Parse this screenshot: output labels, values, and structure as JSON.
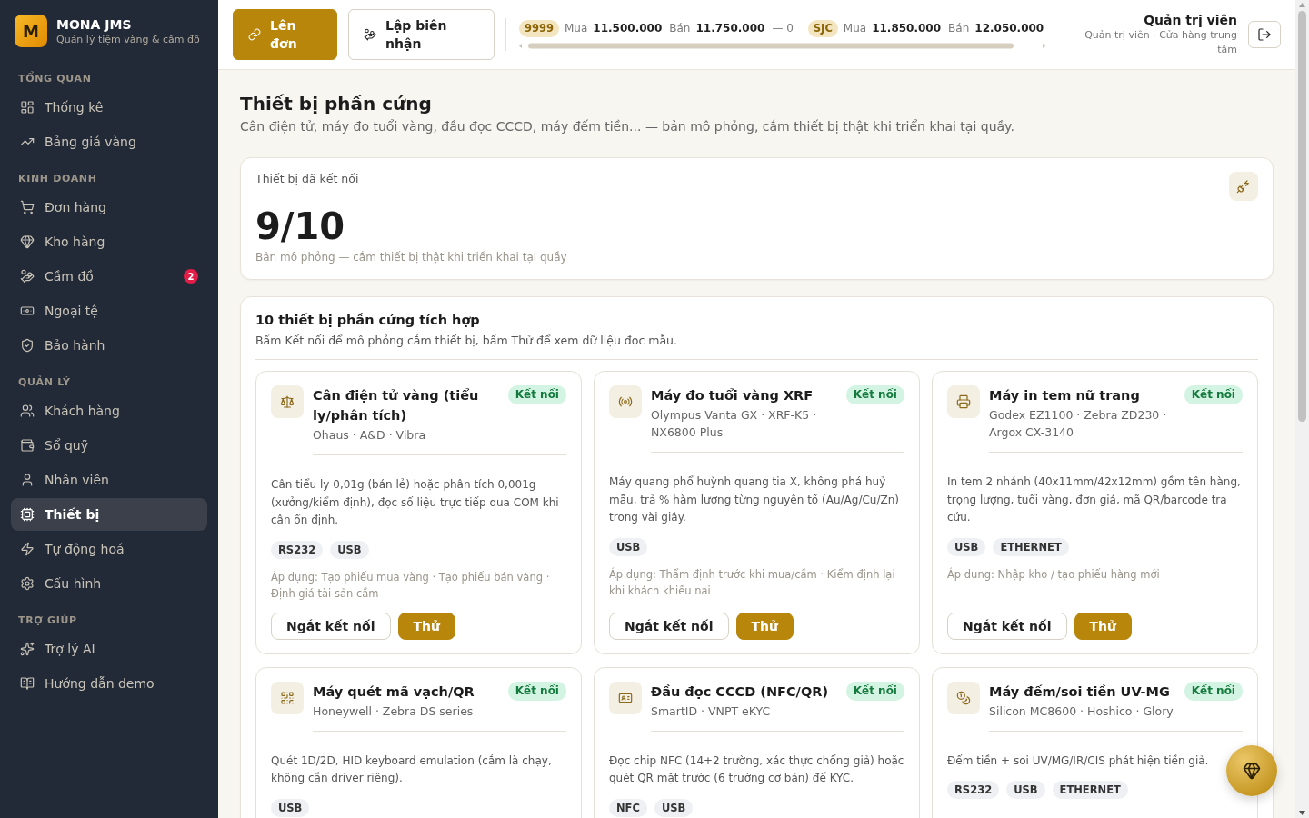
{
  "sidebar": {
    "brand": {
      "logo_letter": "M",
      "name": "MONA JMS",
      "tagline": "Quản lý tiệm vàng & cầm đồ"
    },
    "sections": [
      {
        "title": "TỔNG QUAN",
        "items": [
          {
            "label": "Thống kê",
            "selected": false
          },
          {
            "label": "Bảng giá vàng",
            "selected": false
          }
        ]
      },
      {
        "title": "KINH DOANH",
        "items": [
          {
            "label": "Đơn hàng",
            "selected": false
          },
          {
            "label": "Kho hàng",
            "selected": false
          },
          {
            "label": "Cầm đồ",
            "selected": false,
            "badge": "2"
          },
          {
            "label": "Ngoại tệ",
            "selected": false
          },
          {
            "label": "Bảo hành",
            "selected": false
          }
        ]
      },
      {
        "title": "QUẢN LÝ",
        "items": [
          {
            "label": "Khách hàng",
            "selected": false
          },
          {
            "label": "Sổ quỹ",
            "selected": false
          },
          {
            "label": "Nhân viên",
            "selected": false
          },
          {
            "label": "Thiết bị",
            "selected": true
          },
          {
            "label": "Tự động hoá",
            "selected": false
          },
          {
            "label": "Cấu hình",
            "selected": false
          }
        ]
      },
      {
        "title": "TRỢ GIÚP",
        "items": [
          {
            "label": "Trợ lý AI",
            "selected": false
          },
          {
            "label": "Hướng dẫn demo",
            "selected": false
          }
        ]
      }
    ]
  },
  "topbar": {
    "actions": [
      {
        "label": "Lên đơn",
        "kind": "primary"
      },
      {
        "label": "Lập biên nhận",
        "kind": "secondary"
      }
    ],
    "ticker": [
      {
        "code": "9999",
        "buy_label": "Mua",
        "buy": "11.500.000",
        "sell_label": "Bán",
        "sell": "11.750.000",
        "change": "— 0"
      },
      {
        "code": "SJC",
        "buy_label": "Mua",
        "buy": "11.850.000",
        "sell_label": "Bán",
        "sell": "12.050.000"
      }
    ],
    "user": {
      "name": "Quản trị viên",
      "role": "Quản trị viên · Cửa hàng trung tâm"
    }
  },
  "page": {
    "title": "Thiết bị phần cứng",
    "subtitle": "Cân điện tử, máy đo tuổi vàng, đầu đọc CCCD, máy đếm tiền... — bản mô phỏng, cắm thiết bị thật khi triển khai tại quầy."
  },
  "stat": {
    "label": "Thiết bị đã kết nối",
    "value": "9/10",
    "note": "Bản mô phỏng — cắm thiết bị thật khi triển khai tại quầy"
  },
  "devices": {
    "title": "10 thiết bị phần cứng tích hợp",
    "subtitle": "Bấm Kết nối để mô phỏng cắm thiết bị, bấm Thử để xem dữ liệu đọc mẫu.",
    "items": [
      {
        "name": "Cân điện tử vàng (tiểu ly/phân tích)",
        "status": "Kết nối",
        "models": "Ohaus · A&D · Vibra",
        "description": "Cân tiểu ly 0,01g (bán lẻ) hoặc phân tích 0,001g (xưởng/kiểm định), đọc số liệu trực tiếp qua COM khi cân ổn định.",
        "tags": [
          "RS232",
          "USB"
        ],
        "applies": "Áp dụng: Tạo phiếu mua vàng · Tạo phiếu bán vàng · Định giá tài sản cầm",
        "actions": [
          {
            "label": "Ngắt kết nối",
            "kind": "outline"
          },
          {
            "label": "Thử",
            "kind": "primary"
          }
        ]
      },
      {
        "name": "Máy đo tuổi vàng XRF",
        "status": "Kết nối",
        "models": "Olympus Vanta GX · XRF-K5 · NX6800 Plus",
        "description": "Máy quang phổ huỳnh quang tia X, không phá huỷ mẫu, trả % hàm lượng từng nguyên tố (Au/Ag/Cu/Zn) trong vài giây.",
        "tags": [
          "USB"
        ],
        "applies": "Áp dụng: Thẩm định trước khi mua/cầm · Kiểm định lại khi khách khiếu nại",
        "actions": [
          {
            "label": "Ngắt kết nối",
            "kind": "outline"
          },
          {
            "label": "Thử",
            "kind": "primary"
          }
        ]
      },
      {
        "name": "Máy in tem nữ trang",
        "status": "Kết nối",
        "models": "Godex EZ1100 · Zebra ZD230 · Argox CX-3140",
        "description": "In tem 2 nhánh (40x11mm/42x12mm) gồm tên hàng, trọng lượng, tuổi vàng, đơn giá, mã QR/barcode tra cứu.",
        "tags": [
          "USB",
          "ETHERNET"
        ],
        "applies": "Áp dụng: Nhập kho / tạo phiếu hàng mới",
        "actions": [
          {
            "label": "Ngắt kết nối",
            "kind": "outline"
          },
          {
            "label": "Thử",
            "kind": "primary"
          }
        ]
      },
      {
        "name": "Máy quét mã vạch/QR",
        "status": "Kết nối",
        "models": "Honeywell · Zebra DS series",
        "description": "Quét 1D/2D, HID keyboard emulation (cắm là chạy, không cần driver riêng).",
        "tags": [
          "USB"
        ]
      },
      {
        "name": "Đầu đọc CCCD (NFC/QR)",
        "status": "Kết nối",
        "models": "SmartID · VNPT eKYC",
        "description": "Đọc chip NFC (14+2 trường, xác thực chống giả) hoặc quét QR mặt trước (6 trường cơ bản) để KYC.",
        "tags": [
          "NFC",
          "USB"
        ]
      },
      {
        "name": "Máy đếm/soi tiền UV-MG",
        "status": "Kết nối",
        "models": "Silicon MC8600 · Hoshico · Glory",
        "description": "Đếm tiền + soi UV/MG/IR/CIS phát hiện tiền giả.",
        "tags": [
          "RS232",
          "USB",
          "ETHERNET"
        ]
      }
    ]
  }
}
